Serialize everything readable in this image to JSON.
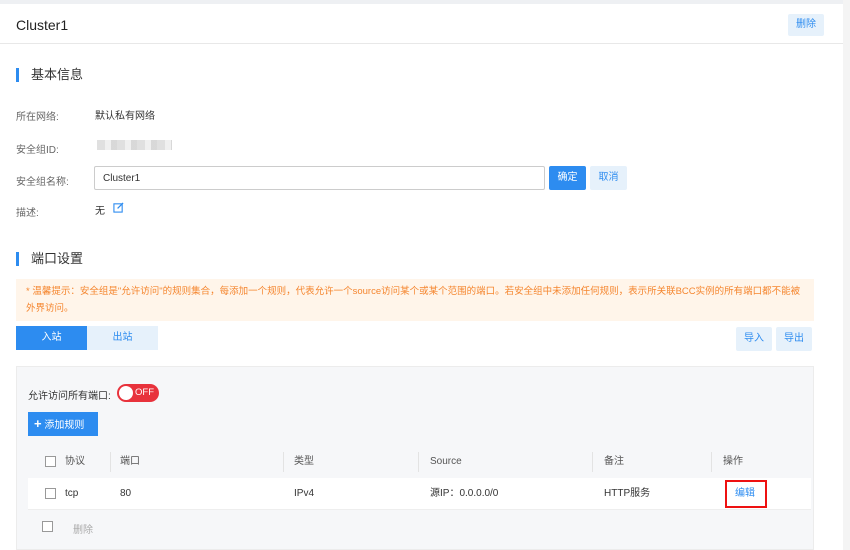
{
  "header": {
    "title": "Cluster1",
    "delete_label": "删除"
  },
  "basic_info": {
    "section_title": "基本信息",
    "network_label": "所在网络:",
    "network_value": "默认私有网络",
    "sgid_label": "安全组ID:",
    "sgname_label": "安全组名称:",
    "sgname_value": "Cluster1",
    "confirm_label": "确定",
    "cancel_label": "取消",
    "desc_label": "描述:",
    "desc_value": "无"
  },
  "port_settings": {
    "section_title": "端口设置",
    "tip": "* 温馨提示：安全组是\"允许访问\"的规则集合，每添加一个规则，代表允许一个source访问某个或某个范围的端口。若安全组中未添加任何规则，表示所关联BCC实例的所有端口都不能被外界访问。",
    "tabs": [
      {
        "label": "入站"
      },
      {
        "label": "出站"
      }
    ],
    "import_label": "导入",
    "export_label": "导出",
    "allow_all_label": "允许访问所有端口:",
    "switch_state": "OFF",
    "add_rule_label": "添加规则",
    "columns": [
      "协议",
      "端口",
      "类型",
      "Source",
      "备注",
      "操作"
    ],
    "rows": [
      {
        "protocol": "tcp",
        "port": "80",
        "type": "IPv4",
        "source": "源IP：0.0.0.0/0",
        "remark": "HTTP服务",
        "action": "编辑"
      }
    ],
    "bulk_delete_label": "删除"
  },
  "colors": {
    "primary": "#2d8cf0",
    "danger": "#e8323c",
    "tip": "#f5862f"
  }
}
